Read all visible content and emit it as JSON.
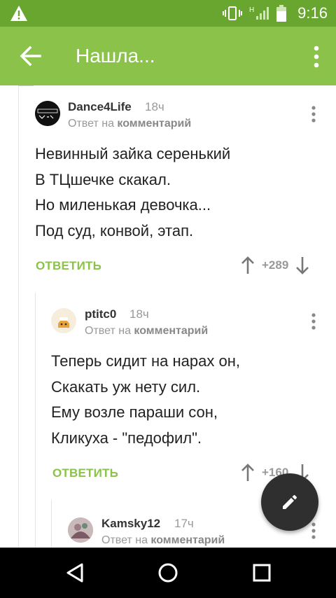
{
  "status": {
    "time": "9:16",
    "network": "H"
  },
  "appbar": {
    "title": "Нашла..."
  },
  "comments": [
    {
      "author": "Dance4Life",
      "age": "18ч",
      "reply_prefix": "Ответ на",
      "reply_target": "комментарий",
      "lines": [
        "Невинный зайка серенький",
        "В ТЦшечке скакал.",
        "Но миленькая девочка...",
        "Под суд, конвой, этап."
      ],
      "reply_label": "ОТВЕТИТЬ",
      "score": "+289",
      "avatar_text": "DEPECHE MODE"
    },
    {
      "author": "ptitc0",
      "age": "18ч",
      "reply_prefix": "Ответ на",
      "reply_target": "комментарий",
      "lines": [
        "Теперь сидит на нарах он,",
        "Скакать уж нету сил.",
        "Ему возле параши сон,",
        "Кликуха - \"педофил\"."
      ],
      "reply_label": "ОТВЕТИТЬ",
      "score": "+160"
    },
    {
      "author": "Kamsky12",
      "age": "17ч",
      "reply_prefix": "Ответ на",
      "reply_target": "комментарий"
    }
  ],
  "colors": {
    "accent": "#8ac24a",
    "statusbar": "#68a630",
    "fab": "#2f2f2f"
  },
  "icons": [
    "warning-icon",
    "vibrate-icon",
    "signal-icon",
    "battery-icon",
    "back-arrow-icon",
    "more-vert-icon",
    "upvote-icon",
    "downvote-icon",
    "edit-pencil-icon",
    "nav-back-icon",
    "nav-home-icon",
    "nav-recents-icon"
  ]
}
